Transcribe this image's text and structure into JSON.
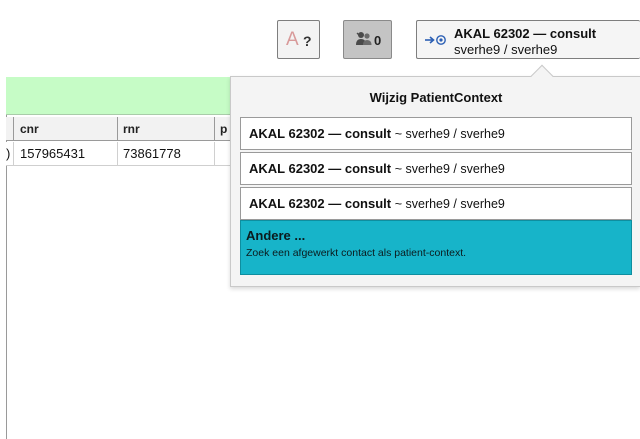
{
  "toolbar": {
    "language_button": {
      "glyph": "A",
      "suffix": "?"
    },
    "users_button": {
      "count": "0"
    },
    "context_button": {
      "title": "AKAL 62302 — consult",
      "subtitle": "sverhe9 / sverhe9"
    }
  },
  "table": {
    "columns": [
      "cnr",
      "rnr",
      "p"
    ],
    "rows": [
      {
        "lead": ")",
        "cnr": "157965431",
        "rnr": "73861778",
        "p": ""
      }
    ]
  },
  "popup": {
    "title": "Wijzig PatientContext",
    "items": [
      {
        "bold": "AKAL 62302 — consult",
        "tail": "~ sverhe9 / sverhe9"
      },
      {
        "bold": "AKAL 62302 — consult",
        "tail": "~ sverhe9 / sverhe9"
      },
      {
        "bold": "AKAL 62302 — consult",
        "tail": "~ sverhe9 / sverhe9"
      }
    ],
    "other": {
      "title": "Andere ...",
      "description": "Zoek een afgewerkt contact als patient-context."
    }
  },
  "colors": {
    "green_band": "#c6fcc6",
    "other_highlight": "#17b4c9",
    "users_button_bg": "#c4c4c4"
  },
  "icons": {
    "language": "language-help-icon",
    "users": "users-icon",
    "context": "context-switch-icon"
  }
}
